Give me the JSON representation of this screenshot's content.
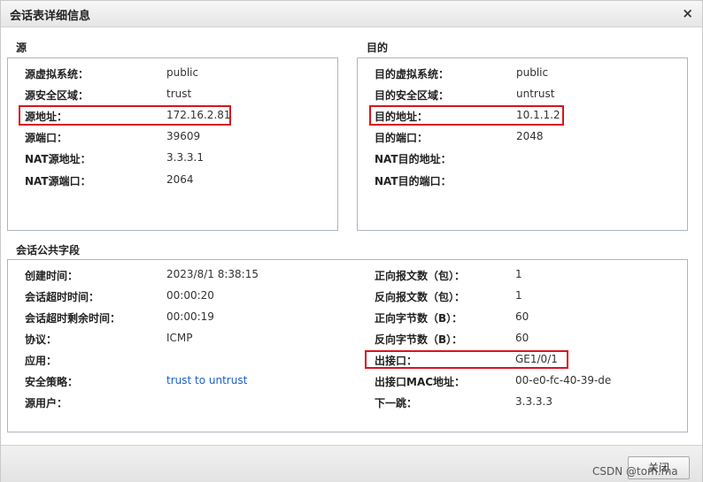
{
  "dialog": {
    "title": "会话表详细信息",
    "close_symbol": "×"
  },
  "source": {
    "heading": "源",
    "rows": [
      {
        "label": "源虚拟系统：",
        "value": "public"
      },
      {
        "label": "源安全区域：",
        "value": "trust"
      },
      {
        "label": "源地址：",
        "value": "172.16.2.81"
      },
      {
        "label": "源端口：",
        "value": "39609"
      },
      {
        "label": "NAT源地址：",
        "value": "3.3.3.1"
      },
      {
        "label": "NAT源端口：",
        "value": "2064"
      }
    ]
  },
  "destination": {
    "heading": "目的",
    "rows": [
      {
        "label": "目的虚拟系统：",
        "value": "public"
      },
      {
        "label": "目的安全区域：",
        "value": "untrust"
      },
      {
        "label": "目的地址：",
        "value": "10.1.1.2"
      },
      {
        "label": "目的端口：",
        "value": "2048"
      },
      {
        "label": "NAT目的地址：",
        "value": ""
      },
      {
        "label": "NAT目的端口：",
        "value": ""
      }
    ]
  },
  "common": {
    "heading": "会话公共字段",
    "left_rows": [
      {
        "label": "创建时间：",
        "value": "2023/8/1 8:38:15"
      },
      {
        "label": "会话超时时间：",
        "value": "00:00:20"
      },
      {
        "label": "会话超时剩余时间：",
        "value": "00:00:19"
      },
      {
        "label": "协议：",
        "value": "ICMP"
      },
      {
        "label": "应用：",
        "value": ""
      },
      {
        "label": "安全策略：",
        "value": "trust to untrust"
      },
      {
        "label": "源用户：",
        "value": ""
      }
    ],
    "right_rows": [
      {
        "label": "正向报文数（包）：",
        "value": "1"
      },
      {
        "label": "反向报文数（包）：",
        "value": "1"
      },
      {
        "label": "正向字节数（B）：",
        "value": "60"
      },
      {
        "label": "反向字节数（B）：",
        "value": "60"
      },
      {
        "label": "出接口：",
        "value": "GE1/0/1"
      },
      {
        "label": "出接口MAC地址：",
        "value": "00-e0-fc-40-39-de"
      },
      {
        "label": "下一跳：",
        "value": "3.3.3.3"
      }
    ]
  },
  "footer": {
    "close_label": "关闭",
    "watermark": "CSDN @tom.ma"
  },
  "colors": {
    "highlight": "#d9141b",
    "link": "#1a5ec9",
    "border": "#aeb5bd"
  }
}
